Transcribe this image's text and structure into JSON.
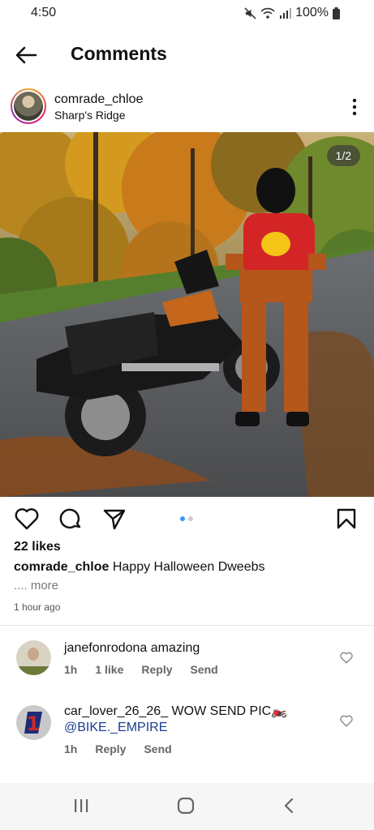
{
  "status": {
    "time": "4:50",
    "battery": "100%"
  },
  "header": {
    "title": "Comments"
  },
  "post": {
    "username": "comrade_chloe",
    "location": "Sharp's Ridge",
    "image_counter": "1/2",
    "likes": "22 likes",
    "caption_user": "comrade_chloe",
    "caption_text": "Happy Halloween Dweebs",
    "more_label": ".... more",
    "time_ago": "1 hour ago",
    "carousel": {
      "total": 2,
      "active": 1
    }
  },
  "comments": [
    {
      "username": "janefonrodona",
      "text": "amazing",
      "time": "1h",
      "likes": "1 like",
      "reply_label": "Reply",
      "send_label": "Send"
    },
    {
      "username": "car_lover_26_26_",
      "text": "WOW SEND PIC🏍️",
      "mention": "@BIKE._EMPIRE",
      "time": "1h",
      "reply_label": "Reply",
      "send_label": "Send"
    }
  ],
  "icons": {
    "back": "arrow-left-icon",
    "more": "more-vertical-icon",
    "like": "heart-icon",
    "comment": "comment-icon",
    "share": "send-icon",
    "save": "bookmark-icon",
    "comment_like": "heart-icon"
  },
  "colors": {
    "accent": "#3897f0",
    "mention": "#1a3d8f"
  }
}
